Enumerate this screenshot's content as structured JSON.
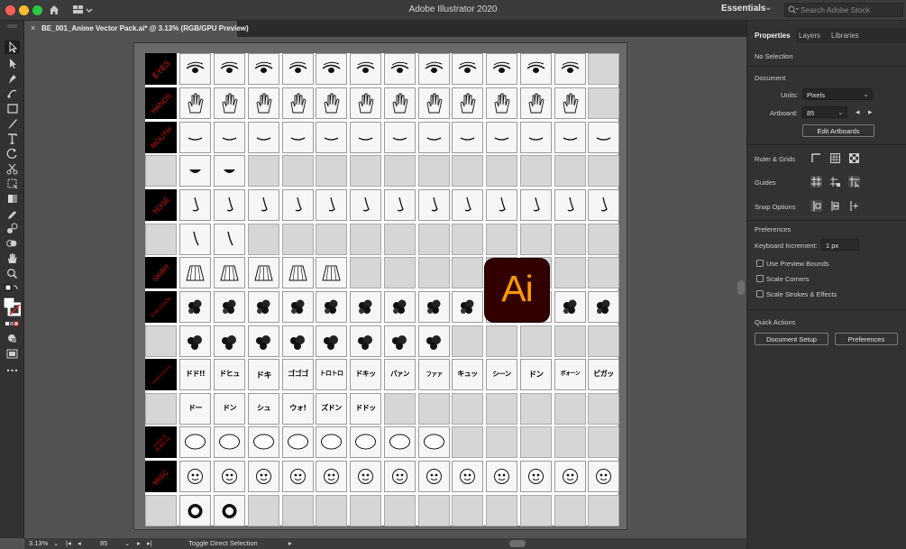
{
  "window": {
    "title": "Adobe Illustrator 2020",
    "workspace": "Essentials",
    "stock_search_placeholder": "Search Adobe Stock"
  },
  "document_tab": {
    "label": "BE_001_Anime Vector Pack.ai* @ 3.13% (RGB/GPU Preview)",
    "close_glyph": "×"
  },
  "artboard_labels": {
    "eyes": "EYES",
    "hands": "HANDS",
    "mouth": "MOUTH",
    "nose": "NOSE",
    "skirt": "SKIRT",
    "explosion": "EXPLOSION",
    "onomatopoeia": "ONOMATOPOEIA",
    "speech": "SPEECH BUBBLES",
    "misc": "MISC."
  },
  "onomatopoeia_row1": [
    "ドド!!",
    "ドヒュ",
    "ドキ",
    "ゴゴゴ",
    "トロトロ",
    "ドキッ",
    "パァン",
    "ファァ",
    "キュッ",
    "シーン",
    "ドン",
    "ボォーン",
    "ビガッ"
  ],
  "onomatopoeia_row2": [
    "ドー",
    "ドン",
    "シュ",
    "ウォ!",
    "ズドン",
    "ドドッ"
  ],
  "center_logo": "Ai",
  "properties_panel": {
    "tabs": [
      "Properties",
      "Layers",
      "Libraries"
    ],
    "selection": "No Selection",
    "document_heading": "Document",
    "units_label": "Units:",
    "units_value": "Pixels",
    "artboard_label": "Artboard:",
    "artboard_value": "85",
    "edit_artboards": "Edit Artboards",
    "ruler_grids": "Ruler & Grids",
    "guides": "Guides",
    "snap_options": "Snap Options",
    "preferences_heading": "Preferences",
    "keyboard_increment_label": "Keyboard Increment:",
    "keyboard_increment_value": "1 px",
    "use_preview_bounds": "Use Preview Bounds",
    "scale_corners": "Scale Corners",
    "scale_strokes": "Scale Strokes & Effects",
    "quick_actions": "Quick Actions",
    "document_setup": "Document Setup",
    "preferences_button": "Preferences"
  },
  "status_bar": {
    "zoom": "3.13%",
    "artboard_number": "85",
    "tool_status": "Toggle Direct Selection"
  },
  "colors": {
    "label_text": "#e01010",
    "ai_logo_bg": "#330000",
    "ai_logo_text": "#ff9a00"
  }
}
